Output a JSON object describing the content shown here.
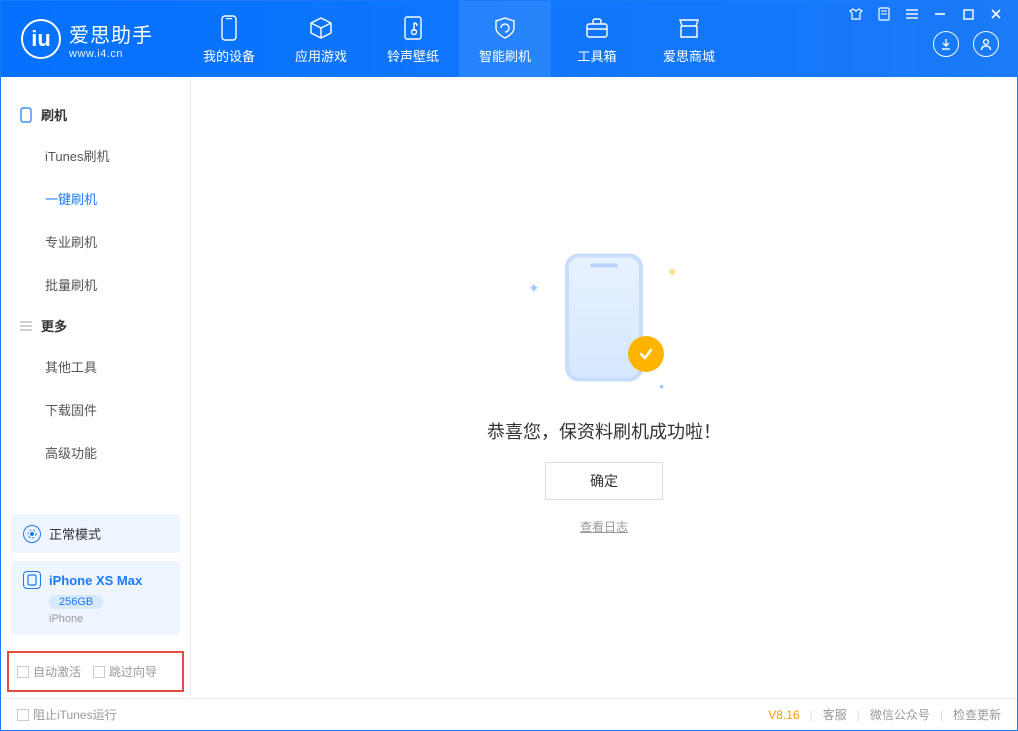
{
  "brand": {
    "name": "爱思助手",
    "site": "www.i4.cn"
  },
  "nav": {
    "items": [
      {
        "label": "我的设备"
      },
      {
        "label": "应用游戏"
      },
      {
        "label": "铃声壁纸"
      },
      {
        "label": "智能刷机"
      },
      {
        "label": "工具箱"
      },
      {
        "label": "爱思商城"
      }
    ],
    "activeIndex": 3
  },
  "sidebar": {
    "group1": {
      "title": "刷机",
      "items": [
        "iTunes刷机",
        "一键刷机",
        "专业刷机",
        "批量刷机"
      ],
      "activeIndex": 1
    },
    "group2": {
      "title": "更多",
      "items": [
        "其他工具",
        "下载固件",
        "高级功能"
      ]
    },
    "mode": {
      "label": "正常模式"
    },
    "device": {
      "name": "iPhone XS Max",
      "storage": "256GB",
      "type": "iPhone"
    },
    "checks": {
      "auto_activate": "自动激活",
      "skip_guide": "跳过向导"
    }
  },
  "main": {
    "success_text": "恭喜您，保资料刷机成功啦！",
    "ok_label": "确定",
    "log_link": "查看日志"
  },
  "statusbar": {
    "block_itunes": "阻止iTunes运行",
    "version": "V8.16",
    "support": "客服",
    "wechat": "微信公众号",
    "check_update": "检查更新"
  }
}
